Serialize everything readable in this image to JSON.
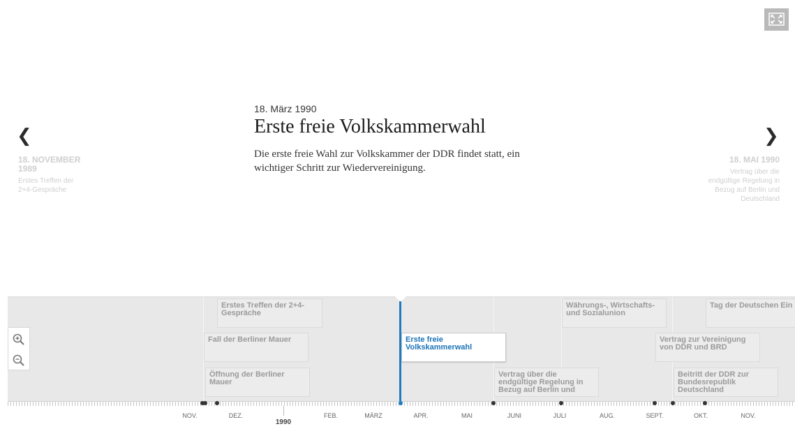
{
  "controls": {
    "fullscreen_icon": "fullscreen-icon",
    "prev_icon": "chevron-left-icon",
    "next_icon": "chevron-right-icon",
    "zoom_in_icon": "zoom-in-icon",
    "zoom_out_icon": "zoom-out-icon",
    "prev_glyph": "❮",
    "next_glyph": "❯"
  },
  "nav": {
    "prev": {
      "date": "18. NOVEMBER 1989",
      "desc": "Erstes Treffen der 2+4-Gespräche"
    },
    "next": {
      "date": "18. MAI 1990",
      "desc": "Vertrag über die endgültige Regelung in Bezug auf Berlin und Deutschland"
    }
  },
  "slide": {
    "date": "18. März 1990",
    "title": "Erste freie Volkskammerwahl",
    "text": "Die erste freie Wahl zur Volkskammer der DDR findet statt, ein wichtiger Schritt zur Wiedervereinigung."
  },
  "timeline": {
    "markers": [
      {
        "label": "Erstes Treffen der 2+4-Gespräche",
        "active": false
      },
      {
        "label": "Fall der Berliner Mauer",
        "active": false
      },
      {
        "label": "Öffnung der Berliner Mauer",
        "active": false
      },
      {
        "label": "Erste freie Volkskammerwahl",
        "active": true
      },
      {
        "label": "Vertrag über die endgültige Regelung in Bezug auf Berlin und",
        "active": false
      },
      {
        "label": "Währungs-, Wirtschafts- und Sozialunion",
        "active": false
      },
      {
        "label": "Vertrag zur Vereinigung von DDR und BRD",
        "active": false
      },
      {
        "label": "Beitritt der DDR zur Bundesrepublik Deutschland",
        "active": false
      },
      {
        "label": "Tag der Deutschen Ein",
        "active": false
      }
    ],
    "months": [
      "NOV.",
      "DEZ.",
      "FEB.",
      "MÄRZ",
      "APR.",
      "MAI",
      "JUNI",
      "JULI",
      "AUG.",
      "SEPT.",
      "OKT.",
      "NOV."
    ],
    "year": "1990",
    "colors": {
      "accent": "#1d7cbf",
      "marker_bg": "#ececec",
      "timeline_bg": "#e8e8e8"
    }
  }
}
